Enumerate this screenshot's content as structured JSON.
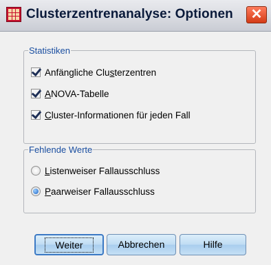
{
  "window": {
    "title": "Clusterzentrenanalyse: Optionen",
    "close_glyph": "✕",
    "app_icon": "spss-data-grid-icon"
  },
  "statistiken": {
    "legend": "Statistiken",
    "options": [
      {
        "label_pre": "Anfängliche Clu",
        "label_mnemonic": "s",
        "label_post": "terzentren",
        "checked": true
      },
      {
        "label_pre": "",
        "label_mnemonic": "A",
        "label_post": "NOVA-Tabelle",
        "checked": true
      },
      {
        "label_pre": "",
        "label_mnemonic": "C",
        "label_post": "luster-Informationen für jeden Fall",
        "checked": true
      }
    ]
  },
  "fehlende_werte": {
    "legend": "Fehlende Werte",
    "options": [
      {
        "label_pre": "",
        "label_mnemonic": "L",
        "label_post": "istenweiser Fallausschluss",
        "selected": false
      },
      {
        "label_pre": "",
        "label_mnemonic": "P",
        "label_post": "aarweiser Fallausschluss",
        "selected": true
      }
    ]
  },
  "buttons": {
    "weiter": "Weiter",
    "abbrechen": "Abbrechen",
    "hilfe": "Hilfe"
  },
  "colors": {
    "group_legend": "#1a4ea0",
    "title_text": "#0a1a3a",
    "close_button": "#d43b16",
    "button_face": "#bfdcf3"
  }
}
